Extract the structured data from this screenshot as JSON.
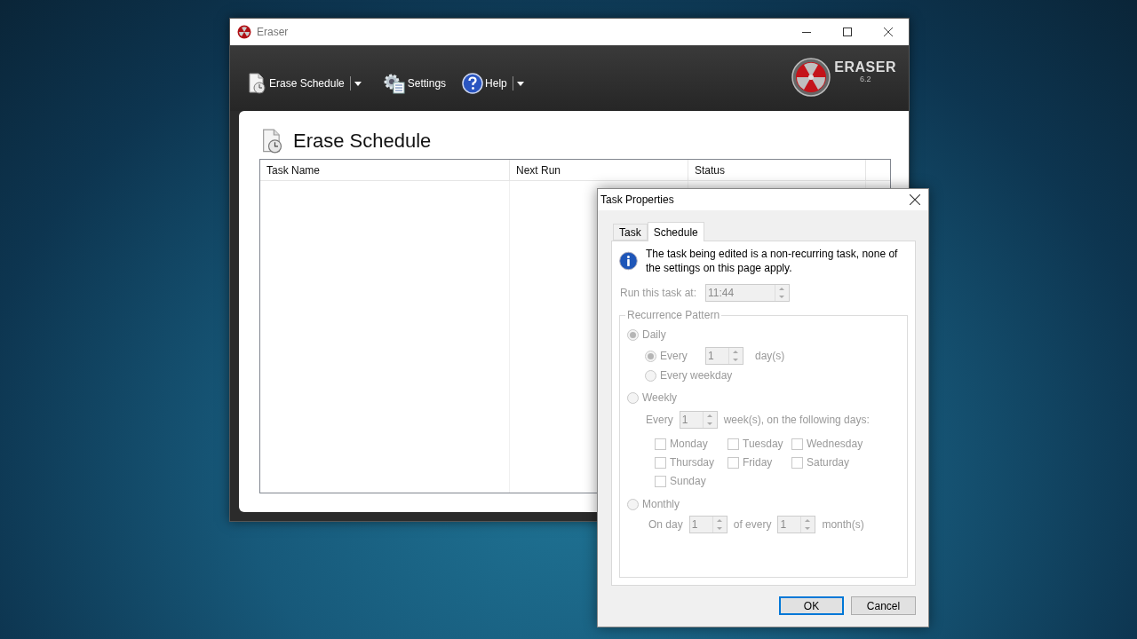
{
  "main_window": {
    "title": "Eraser",
    "toolbar": [
      {
        "label": "Erase Schedule",
        "kind": "schedule",
        "dropdown": true
      },
      {
        "label": "Settings",
        "kind": "settings",
        "dropdown": false
      },
      {
        "label": "Help",
        "kind": "help",
        "dropdown": true
      }
    ],
    "logo": {
      "name": "ERASER",
      "version": "6.2"
    },
    "page_title": "Erase Schedule",
    "table": {
      "columns": [
        "Task Name",
        "Next Run",
        "Status"
      ]
    }
  },
  "dialog": {
    "title": "Task Properties",
    "tabs": [
      {
        "label": "Task",
        "selected": false
      },
      {
        "label": "Schedule",
        "selected": true
      }
    ],
    "info": "The task being edited is a non-recurring task, none of the settings on this page apply.",
    "disabled": true,
    "run_at": {
      "label": "Run this task at:",
      "value": "11:44"
    },
    "recurrence": {
      "legend": "Recurrence Pattern",
      "daily": {
        "label": "Daily",
        "selected": true,
        "every": {
          "label": "Every",
          "selected": true,
          "value": "1",
          "unit": "day(s)"
        },
        "weekday": {
          "label": "Every weekday",
          "selected": false
        }
      },
      "weekly": {
        "label": "Weekly",
        "selected": false,
        "every_label": "Every",
        "value": "1",
        "unit": "week(s), on the following days:",
        "days": [
          {
            "label": "Monday",
            "checked": false
          },
          {
            "label": "Tuesday",
            "checked": false
          },
          {
            "label": "Wednesday",
            "checked": false
          },
          {
            "label": "Thursday",
            "checked": false
          },
          {
            "label": "Friday",
            "checked": false
          },
          {
            "label": "Saturday",
            "checked": false
          },
          {
            "label": "Sunday",
            "checked": false
          }
        ]
      },
      "monthly": {
        "label": "Monthly",
        "selected": false,
        "on_day_label": "On day",
        "day_value": "1",
        "of_every_label": "of every",
        "month_value": "1",
        "unit": "month(s)"
      }
    },
    "buttons": [
      {
        "label": "OK",
        "default": true
      },
      {
        "label": "Cancel",
        "default": false
      }
    ]
  }
}
